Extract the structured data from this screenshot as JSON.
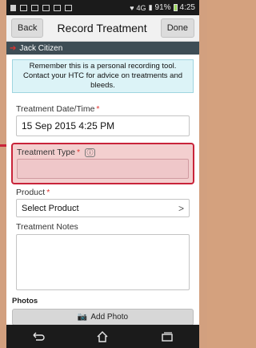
{
  "statusbar": {
    "network": "4G",
    "battery_pct": "91%",
    "time": "4:25"
  },
  "header": {
    "back_label": "Back",
    "title": "Record Treatment",
    "done_label": "Done"
  },
  "patient": {
    "name": "Jack Citizen"
  },
  "notice": {
    "text": "Remember this is a personal recording tool. Contact your HTC for advice on treatments and bleeds."
  },
  "form": {
    "date_label": "Treatment Date/Time",
    "date_value": "15 Sep 2015 4:25 PM",
    "type_label": "Treatment Type",
    "type_value": "",
    "product_label": "Product",
    "product_value": "Select Product",
    "notes_label": "Treatment Notes",
    "notes_value": "",
    "required_mark": "*",
    "info_glyph": "ⓘ"
  },
  "photos": {
    "label": "Photos",
    "add_label": "Add Photo"
  },
  "colors": {
    "highlight": "#c9243a",
    "notice_bg": "#dcf3f7",
    "patient_bar": "#3e4d55"
  }
}
